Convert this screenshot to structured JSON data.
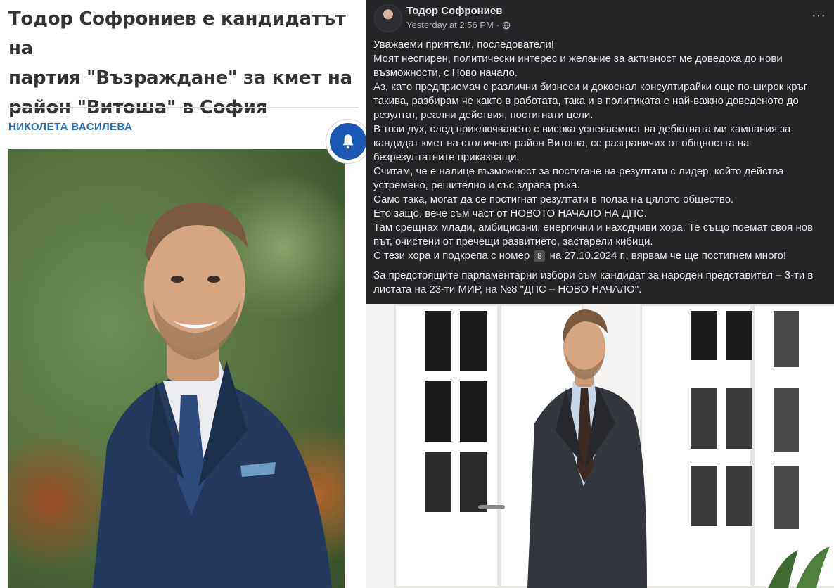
{
  "article": {
    "headline_lines": [
      "Тодор Софрониев е кандидатът на",
      "партия \"Възраждане\" за кмет на",
      "район \"Витоша\" в София"
    ],
    "author": "НИКОЛЕТА ВАСИЛЕВА",
    "notify_icon": "bell-icon",
    "accent_color": "#1e6fc2"
  },
  "post": {
    "author": "Тодор Софрониев",
    "timestamp": "Yesterday at 2:56 PM",
    "separator": "·",
    "privacy_icon": "globe-icon",
    "more_icon": "more-horizontal-icon",
    "paragraphs": [
      "Уважаеми приятели, последователи!",
      "Моят неспирен, политически интерес и желание за активност ме доведоха до нови възможности, с Ново начало.",
      "Аз, като предприемач с различни бизнеси и докоснал консултирайки още по-широк кръг такива, разбирам че както в работата, така и в политиката е най-важно доведеното до резултат, реални действия, постигнати цели.",
      "В този дух, след приключването с висока успеваемост на дебютната ми кампания за кандидат кмет на столичния район Витоша, се разграничих от общността на безрезултатните приказващи.",
      "Считам, че е налице възможност за постигане на резултати с лидер, който действа устремено, решително и със здрава ръка.",
      "Само така, могат да се постигнат резултати в полза на цялото общество.",
      "Ето защо, вече съм част от НОВОТО НАЧАЛО НА ДПС.",
      "Там срещнах млади, амбициозни, енергични и находчиви хора. Те също поемат своя нов път, очистени от пречещи развитието, застарели кибици."
    ],
    "last_line_before": "С тези хора и подкрепа с номер",
    "number_badge": "8",
    "last_line_after": "на 27.10.2024 г., вярвам че ще постигнем много!",
    "closing": "За предстоящите парламентарни избори съм кандидат за народен представител – 3-ти в листата на 23-ти МИР, на №8 \"ДПС – НОВО НАЧАЛО\"."
  }
}
